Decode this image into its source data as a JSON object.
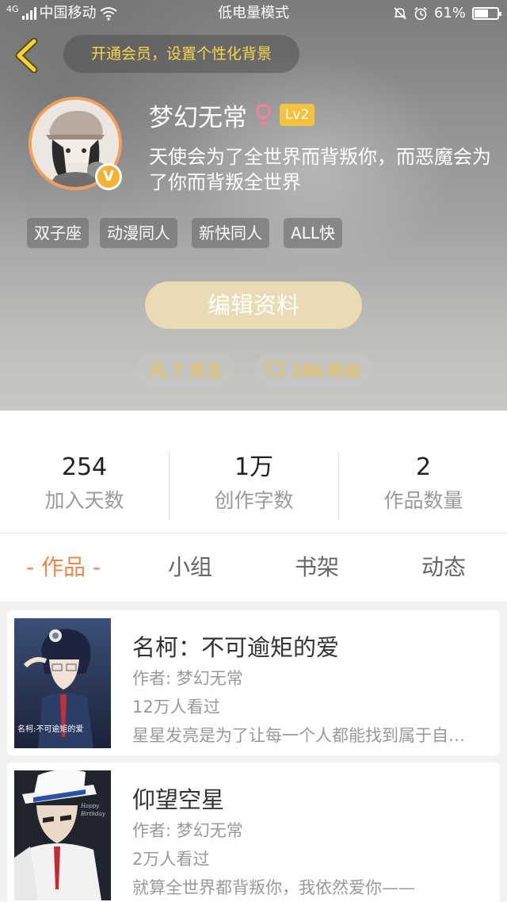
{
  "status_bar": {
    "network": "4G",
    "carrier": "中国移动",
    "mode": "低电量模式",
    "battery": "61%",
    "battery_level": 0.61
  },
  "header": {
    "back_icon": "chevron-left-icon",
    "vip_banner": "开通会员，设置个性化背景",
    "username": "梦幻无常",
    "gender_symbol": "♀",
    "level": "Lv2",
    "verified_badge": "V",
    "bio": "天使会为了全世界而背叛你，而恶魔会为了你而背叛全世界",
    "tags": [
      "双子座",
      "动漫同人",
      "新快同人",
      "ALL快"
    ],
    "edit_button": "编辑资料",
    "following": "7 关注",
    "followers": "186 粉丝"
  },
  "stats": [
    {
      "value": "254",
      "label": "加入天数"
    },
    {
      "value": "1万",
      "label": "创作字数"
    },
    {
      "value": "2",
      "label": "作品数量"
    }
  ],
  "tabs": [
    {
      "label": "- 作品 -",
      "active": true
    },
    {
      "label": "小组",
      "active": false
    },
    {
      "label": "书架",
      "active": false
    },
    {
      "label": "动态",
      "active": false
    }
  ],
  "works": [
    {
      "title": "名柯：不可逾矩的爱",
      "author": "作者: 梦幻无常",
      "views": "12万人看过",
      "description": "星星发亮是为了让每一个人都能找到属于自己的星星",
      "cover_caption": "名柯:不可逾矩的爱"
    },
    {
      "title": "仰望空星",
      "author": "作者: 梦幻无常",
      "views": "2万人看过",
      "description": "就算全世界都背叛你，我依然爱你——",
      "cover_caption": "Happy Birthday"
    }
  ],
  "colors": {
    "accent": "#f0874a",
    "gold": "#f2c544",
    "avatar_ring": "#f0a05a",
    "level_badge": "#f4c23c"
  }
}
